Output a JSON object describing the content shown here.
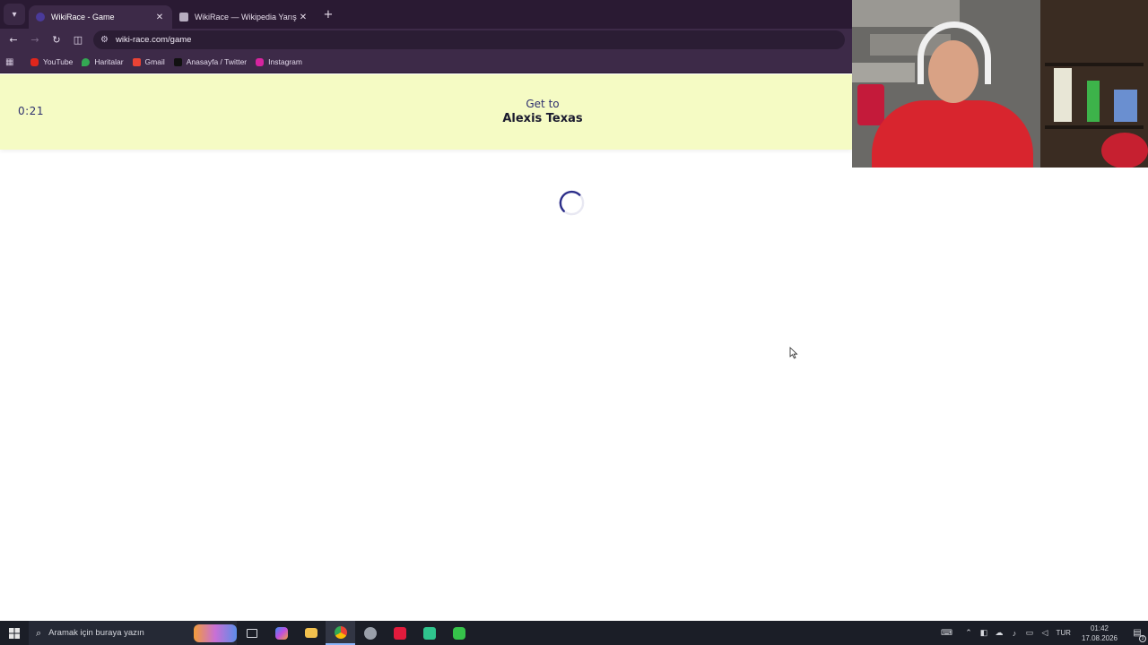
{
  "browser": {
    "tabs": [
      {
        "title": "WikiRace - Game",
        "active": true
      },
      {
        "title": "WikiRace — Wikipedia Yarış Oy",
        "active": false
      }
    ],
    "new_tab_label": "+",
    "url": "wiki-race.com/game",
    "bookmarks": [
      {
        "label": "YouTube",
        "icon": "youtube-icon"
      },
      {
        "label": "Haritalar",
        "icon": "maps-icon"
      },
      {
        "label": "Gmail",
        "icon": "gmail-icon"
      },
      {
        "label": "Anasayfa / Twitter",
        "icon": "x-twitter-icon"
      },
      {
        "label": "Instagram",
        "icon": "instagram-icon"
      }
    ]
  },
  "game": {
    "timer": "0:21",
    "goal_label": "Get to",
    "goal_target": "Alexis Texas",
    "loading": true,
    "header_color": "#f5fbc4",
    "accent_color": "#2d2f6e"
  },
  "taskbar": {
    "search_placeholder": "Aramak için buraya yazın",
    "language": "TUR",
    "time": "01:42",
    "date": "17.08.2026",
    "notification_count": "3",
    "pinned_apps": [
      "task-view-icon",
      "copilot-icon",
      "file-explorer-icon",
      "chrome-icon",
      "settings-icon",
      "opera-icon",
      "app-green-icon",
      "app-hex-icon"
    ]
  }
}
